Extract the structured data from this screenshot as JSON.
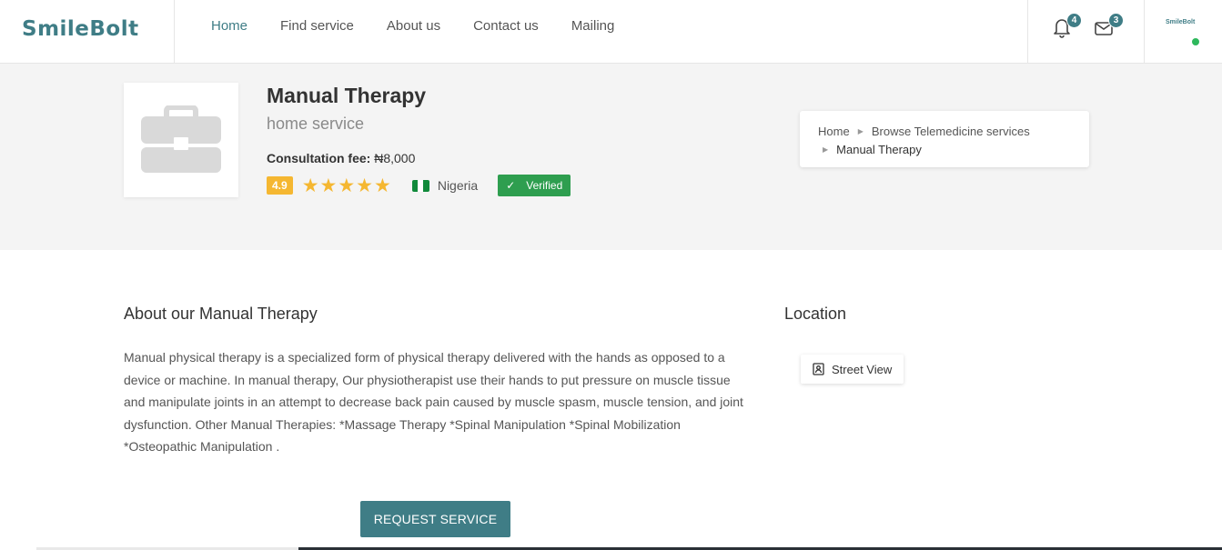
{
  "brand": {
    "logo_text": "SmileBolt",
    "mini_logo_text": "SmileBolt",
    "accent_color": "#3f7d86"
  },
  "nav": {
    "items": [
      {
        "label": "Home",
        "active": true
      },
      {
        "label": "Find service",
        "active": false
      },
      {
        "label": "About us",
        "active": false
      },
      {
        "label": "Contact us",
        "active": false
      },
      {
        "label": "Mailing",
        "active": false
      }
    ],
    "notifications_count": "4",
    "messages_count": "3",
    "notification_icon": "bell-icon",
    "message_icon": "envelope-icon",
    "online_status_color": "#2eb85c"
  },
  "service": {
    "title": "Manual Therapy",
    "subtitle": "home service",
    "fee_label": "Consultation fee:",
    "fee_value": " ₦8,000",
    "rating": "4.9",
    "stars": 5,
    "country": "Nigeria",
    "verified_label": "Verified",
    "image_icon": "briefcase-icon"
  },
  "breadcrumb": {
    "home": "Home",
    "section": "Browse Telemedicine services",
    "current": "Manual Therapy"
  },
  "about": {
    "title": "About our Manual Therapy",
    "text": "Manual physical therapy is a specialized form of physical therapy delivered with the hands as opposed to a device or machine. In manual therapy, Our physiotherapist use their hands to put pressure on muscle tissue and manipulate joints in an attempt to decrease back pain caused by muscle spasm, muscle tension, and joint dysfunction. Other Manual Therapies: *Massage Therapy *Spinal Manipulation *Spinal Mobilization *Osteopathic Manipulation ."
  },
  "location": {
    "title": "Location",
    "street_view_label": "Street View"
  },
  "actions": {
    "request_label": "REQUEST SERVICE"
  }
}
